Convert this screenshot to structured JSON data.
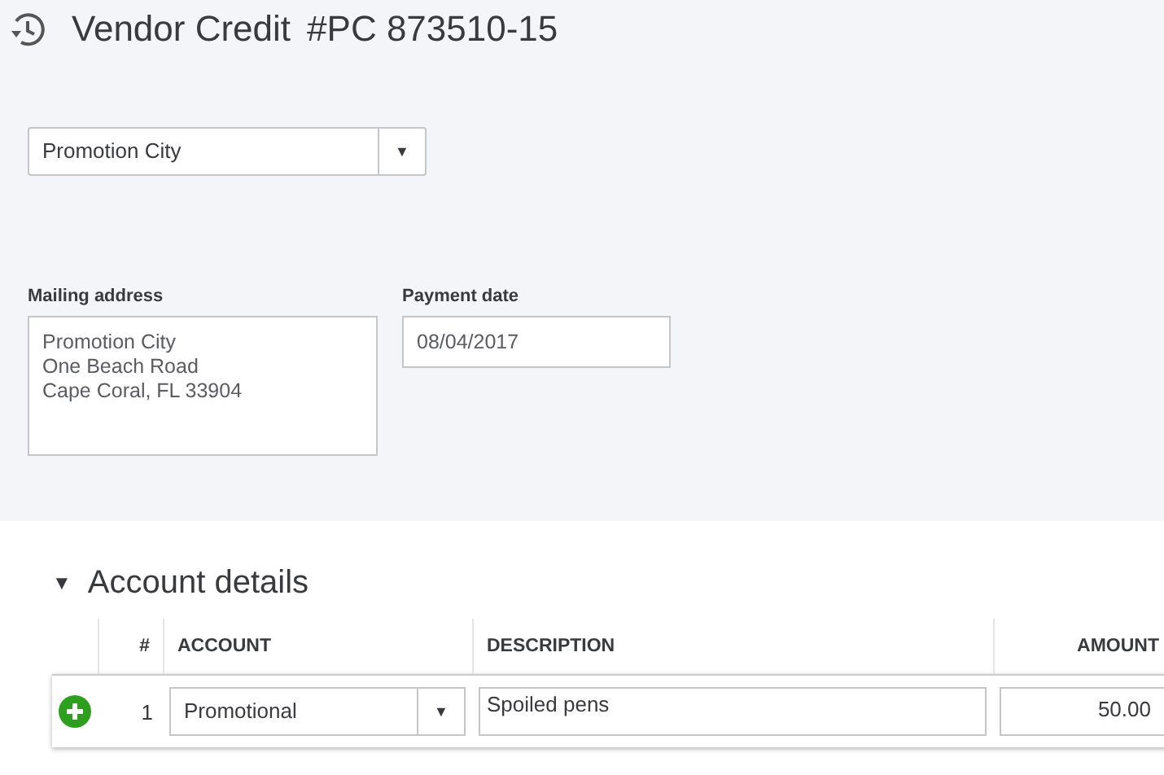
{
  "header": {
    "title": "Vendor Credit",
    "number": "#PC 873510-15"
  },
  "vendor": {
    "value": "Promotion City",
    "caret": "▼"
  },
  "mailing_address": {
    "label": "Mailing address",
    "lines": [
      "Promotion City",
      "One Beach Road",
      "Cape Coral, FL 33904"
    ]
  },
  "payment_date": {
    "label": "Payment date",
    "value": "08/04/2017"
  },
  "account_details": {
    "caret": "▼",
    "title": "Account details",
    "columns": [
      "#",
      "ACCOUNT",
      "DESCRIPTION",
      "AMOUNT"
    ],
    "rows": [
      {
        "number": "1",
        "account": "Promotional",
        "account_caret": "▼",
        "description": "Spoiled pens",
        "amount": "50.00"
      }
    ]
  }
}
